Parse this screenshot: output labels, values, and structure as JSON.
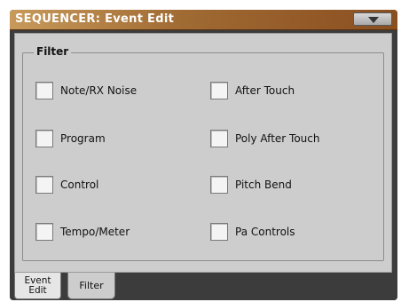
{
  "window": {
    "title": "SEQUENCER: Event Edit"
  },
  "menu_button": {
    "icon": "triangle-down-icon"
  },
  "filter": {
    "label": "Filter",
    "items": [
      {
        "label": "Note/RX Noise"
      },
      {
        "label": "Program"
      },
      {
        "label": "Control"
      },
      {
        "label": "Tempo/Meter"
      },
      {
        "label": "After Touch"
      },
      {
        "label": "Poly After Touch"
      },
      {
        "label": "Pitch Bend"
      },
      {
        "label": "Pa Controls"
      }
    ]
  },
  "tabs": [
    {
      "label_line1": "Event",
      "label_line2": "Edit"
    },
    {
      "label": "Filter"
    }
  ]
}
